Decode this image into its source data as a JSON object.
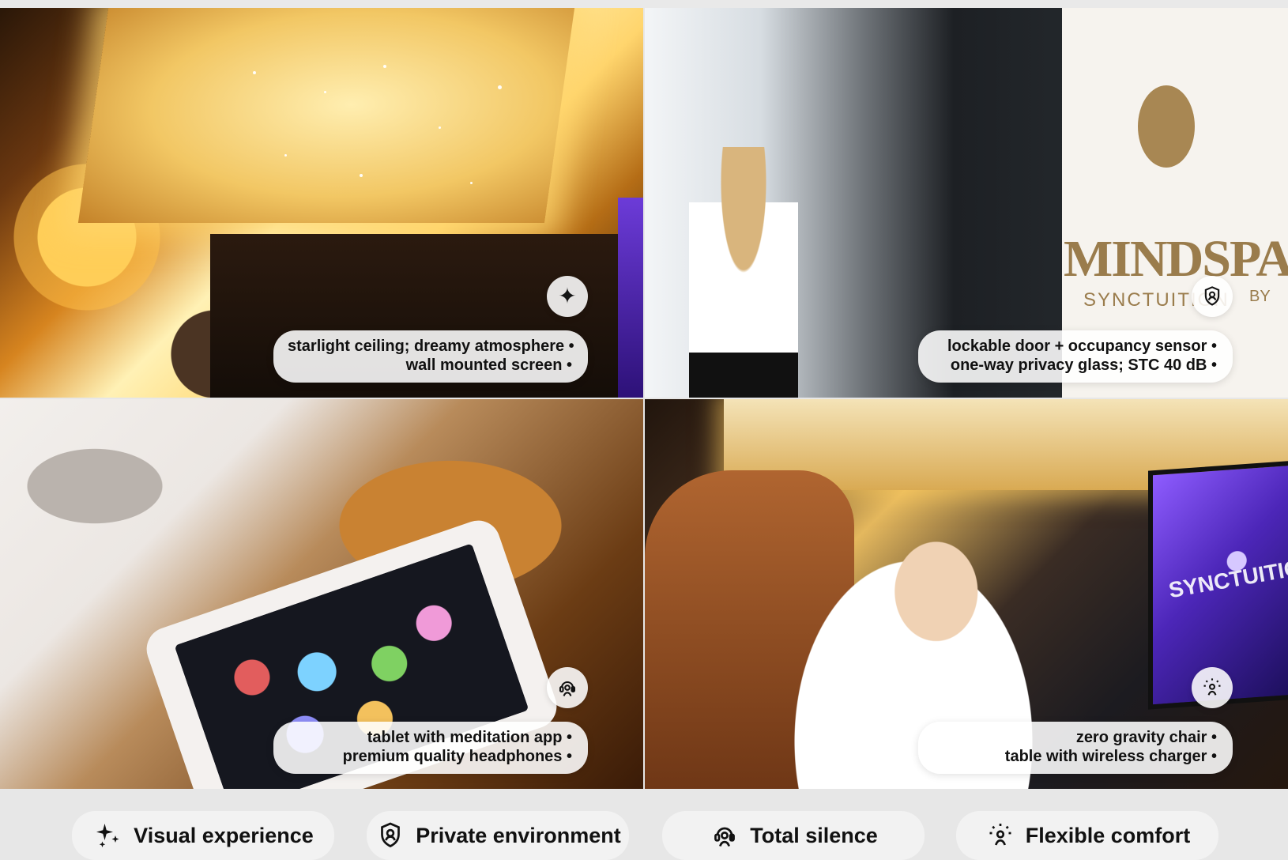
{
  "panels": [
    {
      "caption": {
        "line1": "starlight ceiling; dreamy atmosphere •",
        "line2": "wall mounted screen •"
      },
      "icon": "sparkle-icon"
    },
    {
      "caption": {
        "line1": "lockable door + occupancy sensor •",
        "line2": "one-way privacy glass; STC 40 dB •"
      },
      "icon": "shield-person-icon",
      "sign": {
        "brand": "MINDSPA",
        "sub": "SYNCTUITION",
        "by": "BY"
      }
    },
    {
      "caption": {
        "line1": "tablet with meditation app •",
        "line2": "premium quality headphones •"
      },
      "icon": "person-headphones-icon"
    },
    {
      "caption": {
        "line1": "zero gravity chair •",
        "line2": "table with wireless charger •"
      },
      "icon": "person-spark-icon",
      "screen_text": "SYNCTUITION"
    }
  ],
  "features": [
    {
      "label": "Visual experience",
      "icon": "sparkle-icon"
    },
    {
      "label": "Private environment",
      "icon": "shield-person-icon"
    },
    {
      "label": "Total silence",
      "icon": "person-headphones-icon"
    },
    {
      "label": "Flexible comfort",
      "icon": "person-spark-icon"
    }
  ]
}
